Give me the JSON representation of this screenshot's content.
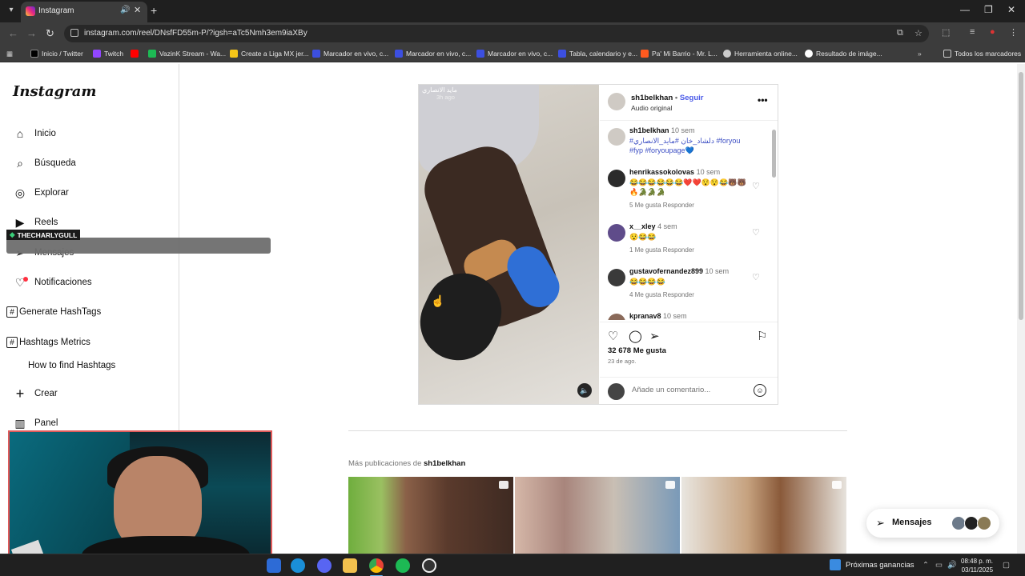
{
  "browser": {
    "tab_title": "Instagram",
    "url": "instagram.com/reel/DNsfFD55m-P/?igsh=aTc5Nmh3em9iaXBy",
    "bookmarks": [
      {
        "label": "Inicio / Twitter",
        "color": "#000000"
      },
      {
        "label": "Twitch",
        "color": "#9146ff"
      },
      {
        "label": "",
        "color": "#ff0000"
      },
      {
        "label": "VazinK Stream - Wa...",
        "color": "#1db954"
      },
      {
        "label": "Create a Liga MX jer...",
        "color": "#f5c518"
      },
      {
        "label": "Marcador en vivo, c...",
        "color": "#3c4fe0"
      },
      {
        "label": "Marcador en vivo, c...",
        "color": "#3c4fe0"
      },
      {
        "label": "Marcador en vivo, c...",
        "color": "#3c4fe0"
      },
      {
        "label": "Tabla, calendario y e...",
        "color": "#3c4fe0"
      },
      {
        "label": "Pa' Mi Barrio - Mr. L...",
        "color": "#ff5a1f"
      },
      {
        "label": "Herramienta online...",
        "color": "#cccccc"
      },
      {
        "label": "Resultado de imáge...",
        "color": "#ffffff"
      }
    ],
    "all_bookmarks": "Todos los marcadores"
  },
  "sidebar": {
    "logo": "Instagram",
    "items": [
      {
        "label": "Inicio",
        "icon": "home-icon"
      },
      {
        "label": "Búsqueda",
        "icon": "search-icon"
      },
      {
        "label": "Explorar",
        "icon": "compass-icon"
      },
      {
        "label": "Reels",
        "icon": "reels-icon"
      },
      {
        "label": "Mensajes",
        "icon": "send-icon"
      },
      {
        "label": "Notificaciones",
        "icon": "heart-icon"
      },
      {
        "label": "Generate HashTags",
        "icon": "hash-icon"
      },
      {
        "label": "Hashtags Metrics",
        "icon": "hash-icon"
      },
      {
        "label": "How to find Hashtags",
        "icon": ""
      },
      {
        "label": "Crear",
        "icon": "plus-icon"
      },
      {
        "label": "Panel",
        "icon": "chart-icon"
      }
    ]
  },
  "overlay": {
    "stream_name": "THECHARLYGULL"
  },
  "reel": {
    "video_tag": "مايد الانصاري",
    "video_time": "3h ago",
    "owner": "sh1belkhan",
    "follow": "Seguir",
    "owner_sub": "Audio original",
    "comments": [
      {
        "user": "sh1belkhan",
        "time": "10 sem",
        "text": "#دلشاد_خان #مايد_الانصاري #foryou #fyp #foryoupage💙",
        "meta": ""
      },
      {
        "user": "henrikassokolovas",
        "time": "10 sem",
        "text": "😂😂😂😂😂😂❤️❤️😯😯😂🐻🐻🔥🐊🐊🐊",
        "meta": "5 Me gusta   Responder"
      },
      {
        "user": "x__xley",
        "time": "4 sem",
        "text": "😯😂😂",
        "meta": "1 Me gusta   Responder"
      },
      {
        "user": "gustavofernandez899",
        "time": "10 sem",
        "text": "😂😂😂😂",
        "meta": "4 Me gusta   Responder"
      },
      {
        "user": "kpranav8",
        "time": "10 sem",
        "text": "",
        "meta": ""
      }
    ],
    "likes": "32 678 Me gusta",
    "date": "23 de ago.",
    "comment_placeholder": "Añade un comentario..."
  },
  "more_posts": {
    "prefix": "Más publicaciones de",
    "owner": "sh1belkhan"
  },
  "messages_pill": {
    "label": "Mensajes"
  },
  "taskbar": {
    "widget": "Próximas ganancias",
    "time": "08:48 p. m.",
    "date": "03/11/2025"
  }
}
